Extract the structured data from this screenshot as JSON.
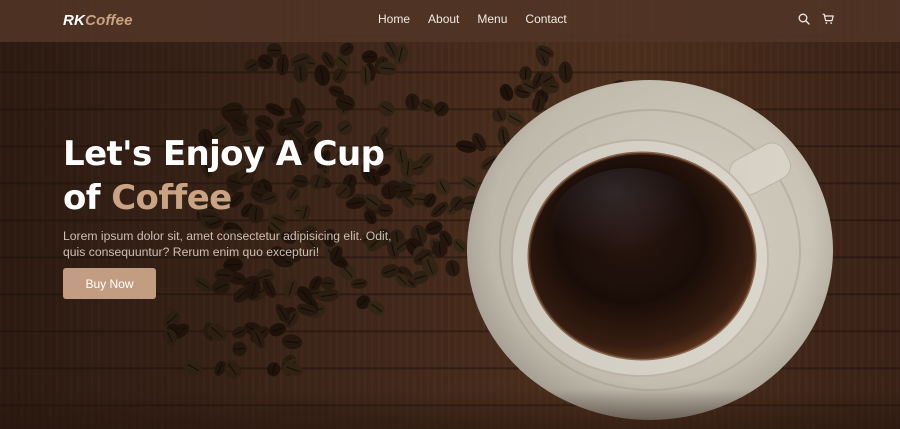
{
  "navbar": {
    "logo_prefix": "RK",
    "logo_brand": "Coffee",
    "links": [
      {
        "label": "Home"
      },
      {
        "label": "About"
      },
      {
        "label": "Menu"
      },
      {
        "label": "Contact"
      }
    ],
    "icons": [
      "search-icon",
      "cart-icon"
    ]
  },
  "hero": {
    "headline_line1": "Let's Enjoy A Cup",
    "headline_of": "of",
    "headline_accent": "Coffee",
    "description": "Lorem ipsum dolor sit, amet consectetur adipisicing elit. Odit, quis consequuntur? Rerum enim quo excepturi!",
    "button_label": "Buy Now"
  },
  "colors": {
    "accent": "#c9a383",
    "button": "#c29d82",
    "navbar": "#503426",
    "text": "#ffffff"
  }
}
